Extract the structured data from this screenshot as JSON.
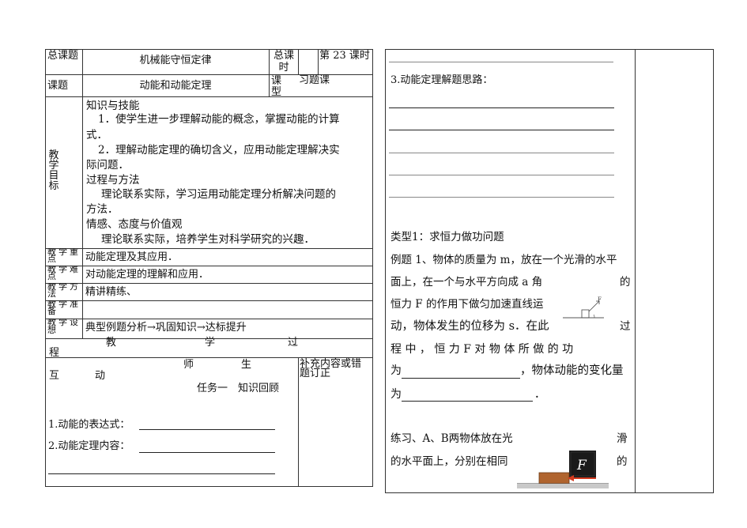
{
  "left": {
    "header": {
      "label1": "总课题",
      "title": "机械能守恒定律",
      "label2": "总课时",
      "period": "第 23 课时"
    },
    "topic": {
      "label": "课题",
      "value": "动能和动能定理",
      "type_label": "课型",
      "type_value": "习题课"
    },
    "goals": {
      "label": "教学目标",
      "lines": [
        "知识与技能",
        "1．使学生进一步理解动能的概念，掌握动能的计算",
        "式．",
        "2．理解动能定理的确切含义，应用动能定理解决实",
        "际问题．",
        "过程与方法",
        "理论联系实际，学习运用动能定理分析解决问题的",
        "方法．",
        "情感、态度与价值观",
        "理论联系实际，培养学生对科学研究的兴趣．"
      ]
    },
    "rows": [
      {
        "label": "教学重点",
        "value": "动能定理及其应用．"
      },
      {
        "label": "教学难点",
        "value": "对动能定理的理解和应用．"
      },
      {
        "label": "教学方法",
        "value": "精讲精练、"
      },
      {
        "label": "教学准备",
        "value": ""
      },
      {
        "label": "教学设想",
        "value": "典型例题分析→巩固知识→达标提升"
      }
    ],
    "process": {
      "chars": [
        "教",
        "学",
        "过",
        "程"
      ]
    },
    "interaction": {
      "chars": [
        "师",
        "生",
        "互",
        "动"
      ],
      "side": "补充内容或错题订正"
    },
    "task": {
      "title": "任务一　知识回顾",
      "q1": "1.动能的表达式：",
      "q2": "2.动能定理内容："
    }
  },
  "right": {
    "section3": "3.动能定理解题思路：",
    "type1": "类型1：求恒力做功问题",
    "example": {
      "l1": "例题 1、物体的质量为 m，放在一个光滑的水平",
      "l2a": "面上，在一个与水平方向成 a 角",
      "l2b": "的",
      "l3": "恒力 F 的作用下做匀加速直线运",
      "l4a": "动，物体发生的位移为 s．在此",
      "l4b": "过",
      "l5": "程 中 ， 恒 力 F 对 物 体 所 做 的 功",
      "l6a": "为",
      "l6b": "，物体动能的变化量",
      "l7a": "为",
      "l7b": "．",
      "fig_label": "F"
    },
    "exercise": {
      "l1a": "练习、A、B两物体放在光",
      "l1b": "滑",
      "l2a": "的水平面上，分别在相同",
      "l2b": "的",
      "fig_label": "F"
    }
  },
  "colors": {
    "line": "#333333",
    "arrow": "#d23a1f",
    "box": "#b0642e",
    "fbox": "#1a1a1a"
  }
}
